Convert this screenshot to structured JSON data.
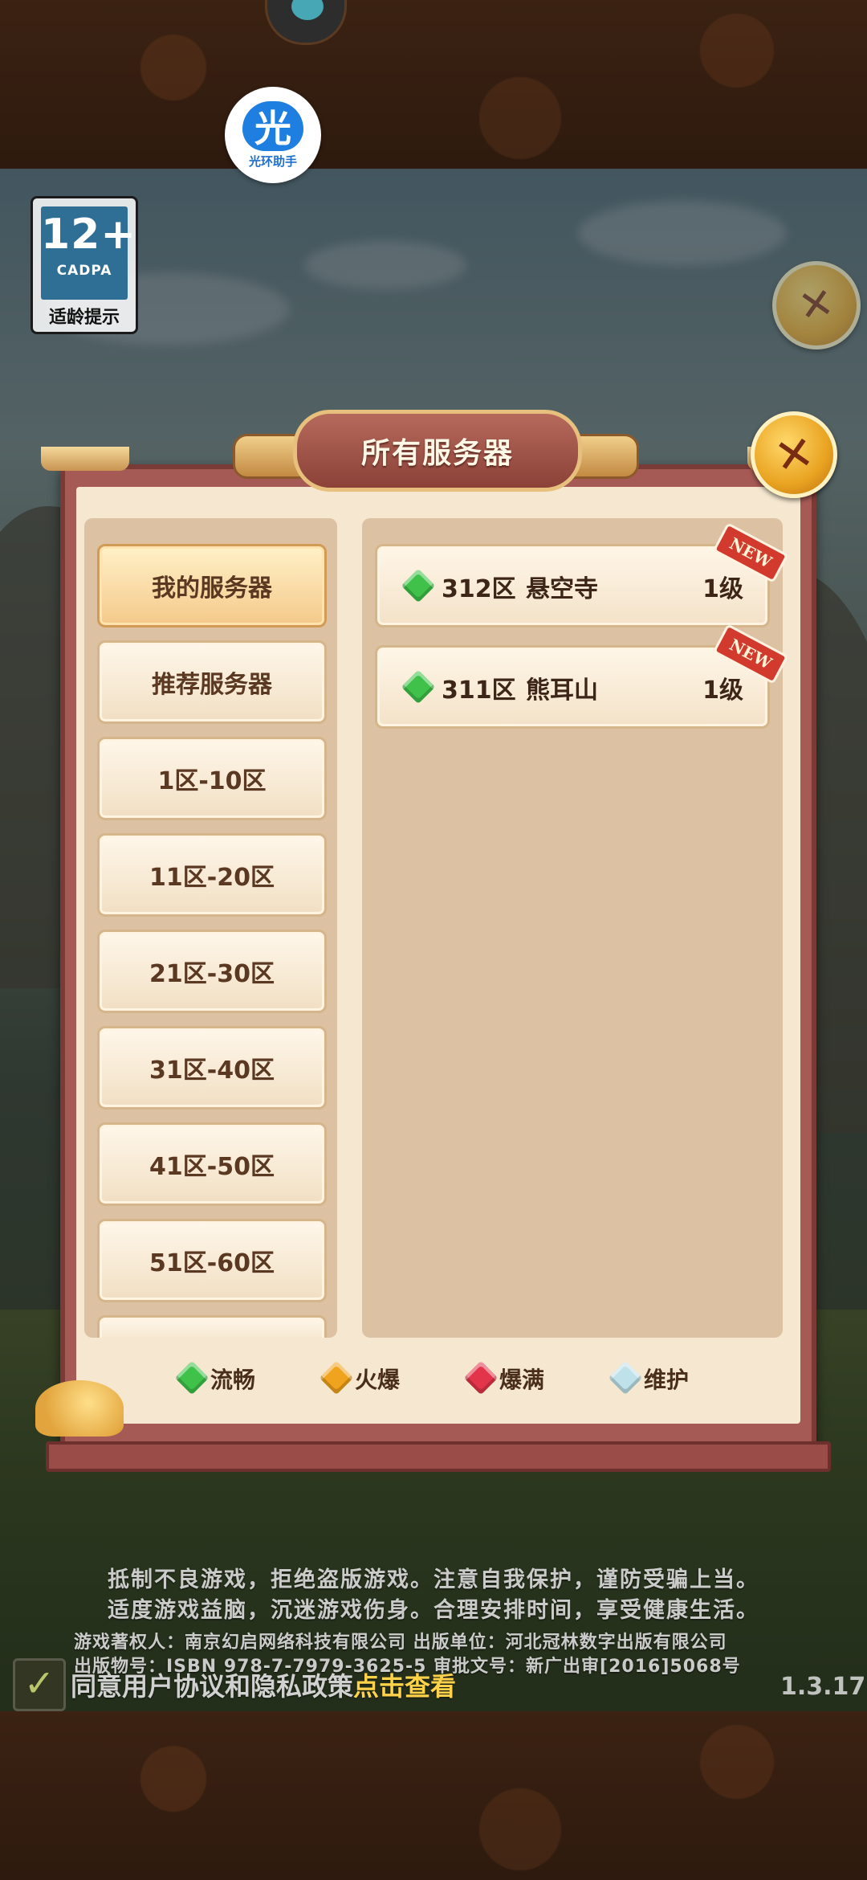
{
  "top_badge": {
    "halo_glyph": "光",
    "halo_label": "光环助手"
  },
  "age_rating": {
    "number": "12+",
    "org": "CADPA",
    "caption": "适龄提示"
  },
  "panel": {
    "title": "所有服务器"
  },
  "categories": [
    {
      "label": "我的服务器",
      "active": true
    },
    {
      "label": "推荐服务器",
      "active": false
    },
    {
      "label": "1区-10区",
      "active": false
    },
    {
      "label": "11区-20区",
      "active": false
    },
    {
      "label": "21区-30区",
      "active": false
    },
    {
      "label": "31区-40区",
      "active": false
    },
    {
      "label": "41区-50区",
      "active": false
    },
    {
      "label": "51区-60区",
      "active": false
    }
  ],
  "servers": [
    {
      "zone": "312区",
      "name": "悬空寺",
      "level": "1级",
      "status": "green",
      "tag": "NEW"
    },
    {
      "zone": "311区",
      "name": "熊耳山",
      "level": "1级",
      "status": "green",
      "tag": "NEW"
    }
  ],
  "legend": [
    {
      "label": "流畅",
      "color": "green"
    },
    {
      "label": "火爆",
      "color": "orange"
    },
    {
      "label": "爆满",
      "color": "red"
    },
    {
      "label": "维护",
      "color": "blue"
    }
  ],
  "notices": {
    "line1": "抵制不良游戏，拒绝盗版游戏。注意自我保护，谨防受骗上当。",
    "line2": "适度游戏益脑，沉迷游戏伤身。合理安排时间，享受健康生活。",
    "line3": "游戏著权人：南京幻启网络科技有限公司 出版单位：河北冠林数字出版有限公司",
    "line4": "出版物号：ISBN 978-7-7979-3625-5 审批文号：新广出审[2016]5068号"
  },
  "agreement": {
    "text": "同意用户协议和隐私政策",
    "link": "点击查看",
    "checked_glyph": "✓"
  },
  "version": "1.3.17",
  "icons": {
    "close": "x-close-icon"
  }
}
